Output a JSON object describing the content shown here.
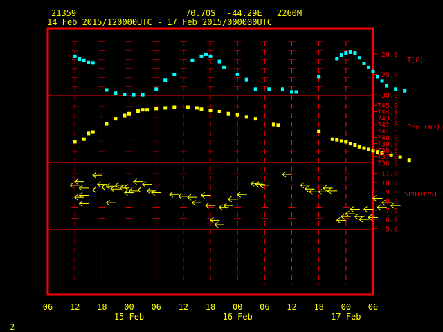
{
  "header": {
    "station_id": "21359",
    "latitude": "70.70S",
    "longitude": "-44.29E",
    "elevation": "2260M",
    "time_range": "14 Feb 2015/120000UTC - 17 Feb 2015/000000UTC"
  },
  "corner_label": "2",
  "colors": {
    "background": "#000000",
    "frame": "#ff0000",
    "labels": "#ffff00",
    "temperature": "#00ffff",
    "pressure": "#ffff00",
    "wind": "#ffff00"
  },
  "chart_data": {
    "type": "scatter",
    "x_unit": "hours since 14 Feb 2015 00:00 UTC",
    "x_range": [
      6,
      78
    ],
    "x_tick_labels": [
      "06",
      "12",
      "18",
      "00",
      "06",
      "12",
      "18",
      "00",
      "06",
      "12",
      "18",
      "00",
      "06"
    ],
    "date_labels": [
      {
        "label": "15 Feb",
        "hour": 24
      },
      {
        "label": "16 Feb",
        "hour": 48
      },
      {
        "label": "17 Feb",
        "hour": 72
      }
    ],
    "panels": [
      {
        "name": "T(C)",
        "y_range": [
          -31.5,
          -17
        ],
        "y_ticks": [
          -20.0,
          -25.0,
          -30.0
        ],
        "points": [
          [
            12,
            -20.6
          ],
          [
            13,
            -21.3
          ],
          [
            14,
            -21.6
          ],
          [
            15,
            -22.1
          ],
          [
            16,
            -22.2
          ],
          [
            19,
            -28.8
          ],
          [
            21,
            -29.6
          ],
          [
            23,
            -29.9
          ],
          [
            25,
            -30.0
          ],
          [
            27,
            -30.0
          ],
          [
            30,
            -28.6
          ],
          [
            32,
            -26.4
          ],
          [
            34,
            -25.0
          ],
          [
            38,
            -21.6
          ],
          [
            40,
            -20.6
          ],
          [
            41,
            -20.1
          ],
          [
            42,
            -20.6
          ],
          [
            44,
            -21.9
          ],
          [
            45,
            -23.3
          ],
          [
            48,
            -25.0
          ],
          [
            50,
            -26.3
          ],
          [
            52,
            -28.6
          ],
          [
            55,
            -28.6
          ],
          [
            58,
            -28.6
          ],
          [
            60,
            -29.3
          ],
          [
            61,
            -29.3
          ],
          [
            66,
            -25.6
          ],
          [
            70,
            -21.2
          ],
          [
            71,
            -20.3
          ],
          [
            72,
            -19.8
          ],
          [
            73,
            -19.6
          ],
          [
            74,
            -19.8
          ],
          [
            75,
            -21.0
          ],
          [
            76,
            -22.3
          ],
          [
            77,
            -23.3
          ],
          [
            78,
            -24.3
          ],
          [
            79,
            -25.6
          ],
          [
            80,
            -26.6
          ],
          [
            81,
            -27.8
          ],
          [
            83,
            -28.6
          ],
          [
            85,
            -29.0
          ]
        ]
      },
      {
        "name": "Pre (mb)",
        "y_range": [
          735.5,
          746
        ],
        "y_ticks": [
          745.0,
          744.0,
          743.0,
          742.0,
          741.0,
          740.0,
          739.0,
          738.0,
          737.0,
          736.0
        ],
        "points": [
          [
            12,
            739.3
          ],
          [
            14,
            739.7
          ],
          [
            15,
            740.6
          ],
          [
            16,
            740.8
          ],
          [
            19,
            742.1
          ],
          [
            21,
            742.9
          ],
          [
            23,
            743.4
          ],
          [
            24,
            743.7
          ],
          [
            26,
            744.1
          ],
          [
            27,
            744.3
          ],
          [
            28,
            744.3
          ],
          [
            30,
            744.5
          ],
          [
            32,
            744.6
          ],
          [
            34,
            744.7
          ],
          [
            37,
            744.7
          ],
          [
            39,
            744.6
          ],
          [
            40,
            744.4
          ],
          [
            42,
            744.2
          ],
          [
            44,
            744.0
          ],
          [
            46,
            743.7
          ],
          [
            48,
            743.5
          ],
          [
            50,
            743.2
          ],
          [
            52,
            742.9
          ],
          [
            56,
            742.0
          ],
          [
            57,
            741.9
          ],
          [
            66,
            740.9
          ],
          [
            69,
            739.7
          ],
          [
            70,
            739.6
          ],
          [
            71,
            739.4
          ],
          [
            72,
            739.3
          ],
          [
            73,
            739.0
          ],
          [
            74,
            738.8
          ],
          [
            75,
            738.5
          ],
          [
            76,
            738.3
          ],
          [
            77,
            738.1
          ],
          [
            78,
            737.9
          ],
          [
            79,
            737.7
          ],
          [
            80,
            737.5
          ],
          [
            82,
            737.2
          ],
          [
            84,
            736.9
          ],
          [
            86,
            736.4
          ]
        ]
      },
      {
        "name": "SPD(MPS)",
        "y_range": [
          4.5,
          11.5
        ],
        "y_ticks": [
          11.0,
          10.0,
          9.0,
          8.0,
          7.0,
          6.0,
          5.0
        ],
        "wind_direction": "east (arrows point west)",
        "points": [
          [
            12,
            9.7
          ],
          [
            13,
            10.1
          ],
          [
            13,
            8.4
          ],
          [
            14,
            9.4
          ],
          [
            14,
            8.6
          ],
          [
            14,
            7.7
          ],
          [
            17,
            10.8
          ],
          [
            17,
            9.2
          ],
          [
            18,
            9.8
          ],
          [
            19,
            9.5
          ],
          [
            20,
            9.6
          ],
          [
            20,
            7.8
          ],
          [
            21,
            9.3
          ],
          [
            22,
            9.7
          ],
          [
            23,
            9.4
          ],
          [
            24,
            9.5
          ],
          [
            24,
            8.9
          ],
          [
            25,
            9.1
          ],
          [
            26,
            10.1
          ],
          [
            27,
            9.2
          ],
          [
            28,
            9.8
          ],
          [
            29,
            9.1
          ],
          [
            30,
            8.9
          ],
          [
            34,
            8.7
          ],
          [
            36,
            8.5
          ],
          [
            38,
            8.4
          ],
          [
            39,
            7.8
          ],
          [
            41,
            8.6
          ],
          [
            42,
            7.5
          ],
          [
            43,
            5.9
          ],
          [
            44,
            5.4
          ],
          [
            45,
            7.3
          ],
          [
            46,
            7.5
          ],
          [
            47,
            8.2
          ],
          [
            49,
            8.7
          ],
          [
            52,
            9.9
          ],
          [
            53,
            9.8
          ],
          [
            54,
            9.7
          ],
          [
            59,
            10.9
          ],
          [
            63,
            9.7
          ],
          [
            64,
            9.3
          ],
          [
            65,
            9.0
          ],
          [
            67,
            9.0
          ],
          [
            68,
            9.4
          ],
          [
            69,
            9.1
          ],
          [
            71,
            5.9
          ],
          [
            72,
            6.3
          ],
          [
            73,
            6.6
          ],
          [
            74,
            7.1
          ],
          [
            75,
            6.3
          ],
          [
            76,
            6.0
          ],
          [
            77,
            7.1
          ],
          [
            78,
            6.2
          ],
          [
            79,
            8.3
          ],
          [
            80,
            7.3
          ],
          [
            81,
            7.8
          ],
          [
            83,
            7.5
          ]
        ]
      }
    ]
  }
}
